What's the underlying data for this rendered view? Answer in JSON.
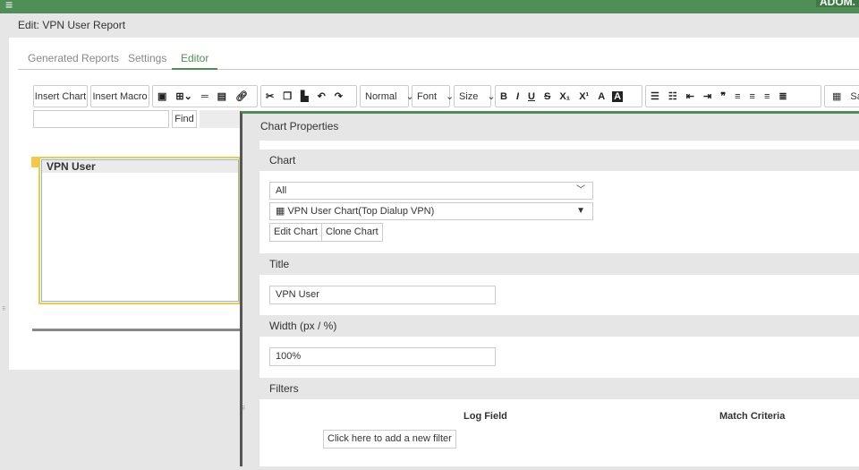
{
  "header": {
    "menu_icon": "≡",
    "adom": "ADOM."
  },
  "page_title": "Edit: VPN User Report",
  "tabs": [
    "Generated Reports",
    "Settings",
    "Editor"
  ],
  "toolbar": {
    "insert_chart": "Insert Chart",
    "insert_macro": "Insert Macro",
    "format": "Normal",
    "font": "Font",
    "size": "Size",
    "save": "Save"
  },
  "find": {
    "value": "",
    "button": "Find"
  },
  "editor": {
    "chart_title": "VPN User"
  },
  "panel": {
    "title": "Chart Properties",
    "chart_section": "Chart",
    "category_select": "All",
    "chart_select": "VPN User Chart(Top Dialup VPN)",
    "edit_chart": "Edit Chart",
    "clone_chart": "Clone Chart",
    "title_section": "Title",
    "title_value": "VPN User",
    "width_section": "Width (px / %)",
    "width_value": "100%",
    "filters_section": "Filters",
    "col_log_field": "Log Field",
    "col_match": "Match Criteria",
    "add_filter": "Click here to add a new filter"
  }
}
